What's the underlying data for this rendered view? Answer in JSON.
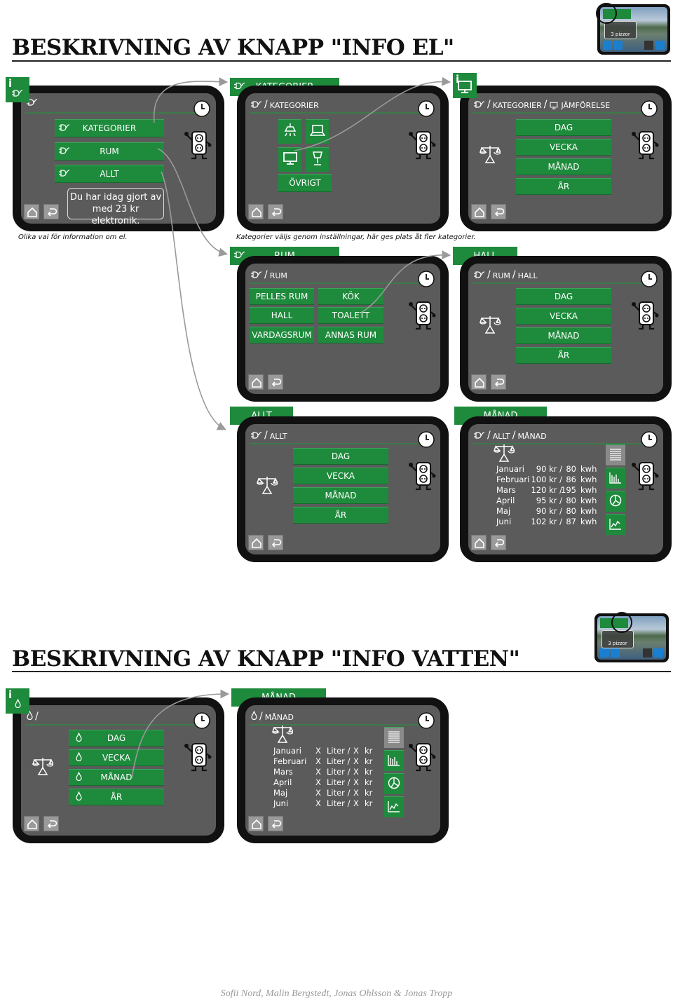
{
  "headings": {
    "el": "BESKRIVNING AV KNAPP \"INFO EL\"",
    "vatten": "BESKRIVNING AV KNAPP \"INFO VATTEN\""
  },
  "captions": {
    "el_options": "Olika val för information om el.",
    "categories": "Kategorier väljs genom inställningar, här ges plats åt fler kategorier."
  },
  "footer": "Sofii Nord, Malin Bergstedt, Jonas Ohlsson & Jonas Tropp",
  "thumbnail": {
    "message": "3 pizzor"
  },
  "breadcrumb_separator": "/",
  "colors": {
    "accent_green": "#1e8a3c",
    "screen_gray": "#5b5b5b",
    "bezel": "#111111",
    "arrow": "#9a9a9a"
  },
  "screens": [
    {
      "tab_icon": "plug-icon",
      "crumb_icon": "plug-icon",
      "breadcrumb": [],
      "buttons": [
        "KATEGORIER",
        "RUM",
        "ALLT"
      ],
      "message": [
        "Du har idag gjort av",
        "med 23 kr elektronik."
      ]
    },
    {
      "tab_label": "KATEGORIER",
      "tab_icon": "plug-icon",
      "crumb_icon": "plug-icon",
      "breadcrumb": [
        "KATEGORIER"
      ],
      "icon_buttons": [
        "ceiling-lamp-icon",
        "laptop-icon",
        "monitor-icon",
        "desk-lamp-icon"
      ],
      "buttons": [
        "ÖVRIGT"
      ]
    },
    {
      "tab_icon": "monitor-icon",
      "crumb_icon": "plug-icon",
      "breadcrumb": [
        "KATEGORIER",
        "JÄMFÖRELSE"
      ],
      "buttons": [
        "DAG",
        "VECKA",
        "MÅNAD",
        "ÅR"
      ]
    },
    {
      "tab_label": "RUM",
      "tab_icon": "plug-icon",
      "crumb_icon": "plug-icon",
      "breadcrumb": [
        "RUM"
      ],
      "buttons": [
        "PELLES RUM",
        "KÖK",
        "HALL",
        "TOALETT",
        "VARDAGSRUM",
        "ANNAS RUM"
      ]
    },
    {
      "tab_label": "HALL",
      "crumb_icon": "plug-icon",
      "breadcrumb": [
        "RUM",
        "HALL"
      ],
      "buttons": [
        "DAG",
        "VECKA",
        "MÅNAD",
        "ÅR"
      ]
    },
    {
      "tab_label": "ALLT",
      "crumb_icon": "plug-icon",
      "breadcrumb": [
        "ALLT"
      ],
      "buttons": [
        "DAG",
        "VECKA",
        "MÅNAD",
        "ÅR"
      ]
    },
    {
      "tab_label": "MÅNAD",
      "crumb_icon": "plug-icon",
      "breadcrumb": [
        "ALLT",
        "MÅNAD"
      ],
      "table": [
        [
          "Januari",
          "90 kr /",
          "80",
          "kwh"
        ],
        [
          "Februari",
          "100 kr /",
          "86",
          "kwh"
        ],
        [
          "Mars",
          "120 kr /",
          "195",
          "kwh"
        ],
        [
          "April",
          "95 kr /",
          "80",
          "kwh"
        ],
        [
          "Maj",
          "90 kr /",
          "80",
          "kwh"
        ],
        [
          "Juni",
          "102 kr /",
          "87",
          "kwh"
        ]
      ],
      "side_buttons": [
        "list-icon",
        "bar-chart-icon",
        "pie-chart-icon",
        "line-chart-icon"
      ]
    },
    {
      "tab_icon": "water-drop-icon",
      "crumb_icon": "water-drop-icon",
      "breadcrumb": [
        ""
      ],
      "buttons": [
        "DAG",
        "VECKA",
        "MÅNAD",
        "ÅR"
      ]
    },
    {
      "tab_label": "MÅNAD",
      "crumb_icon": "water-drop-icon",
      "breadcrumb": [
        "MÅNAD"
      ],
      "table": [
        [
          "Januari",
          "X",
          "Liter /",
          "X",
          "kr"
        ],
        [
          "Februari",
          "X",
          "Liter /",
          "X",
          "kr"
        ],
        [
          "Mars",
          "X",
          "Liter /",
          "X",
          "kr"
        ],
        [
          "April",
          "X",
          "Liter /",
          "X",
          "kr"
        ],
        [
          "Maj",
          "X",
          "Liter /",
          "X",
          "kr"
        ],
        [
          "Juni",
          "X",
          "Liter /",
          "X",
          "kr"
        ]
      ],
      "side_buttons": [
        "list-icon",
        "bar-chart-icon",
        "pie-chart-icon",
        "line-chart-icon"
      ]
    }
  ]
}
